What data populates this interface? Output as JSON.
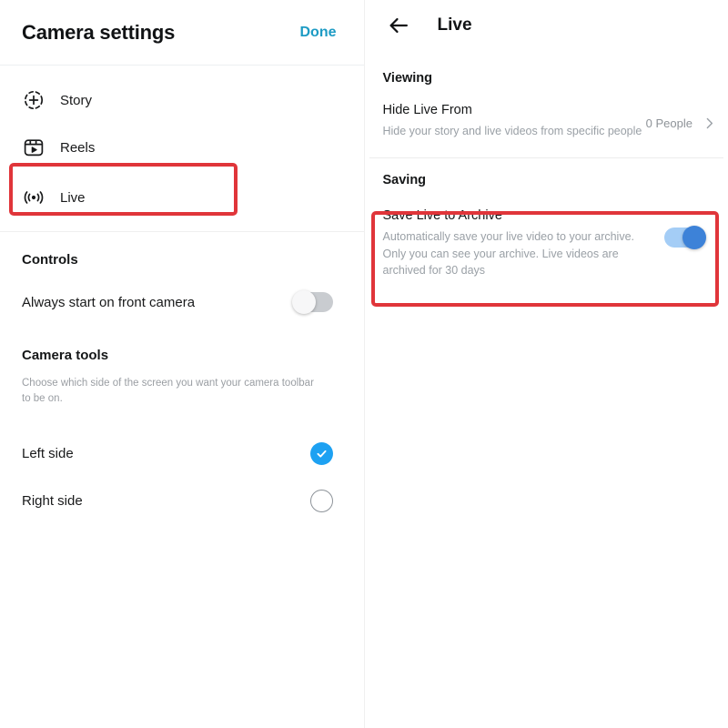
{
  "left_panel": {
    "title": "Camera settings",
    "done_label": "Done",
    "modes": [
      {
        "label": "Story",
        "icon": "story-add-icon"
      },
      {
        "label": "Reels",
        "icon": "reels-clapper-icon"
      },
      {
        "label": "Live",
        "icon": "live-broadcast-icon"
      }
    ],
    "controls": {
      "section_title": "Controls",
      "front_camera_label": "Always start on front camera",
      "front_camera_state": "off"
    },
    "camera_tools": {
      "section_title": "Camera tools",
      "description": "Choose which side of the screen you want your camera toolbar to be on.",
      "options": [
        {
          "label": "Left side",
          "selected": true,
          "control": "check-icon"
        },
        {
          "label": "Right side",
          "selected": false,
          "control": "radio-empty-icon"
        }
      ]
    }
  },
  "right_panel": {
    "back_icon": "back-arrow-icon",
    "title": "Live",
    "viewing": {
      "section_title": "Viewing",
      "row": {
        "title": "Hide Live From",
        "subtitle": "Hide your story and live videos from specific people",
        "value": "0 People",
        "chevron": "chevron-right-icon"
      }
    },
    "saving": {
      "section_title": "Saving",
      "row": {
        "title": "Save Live to Archive",
        "subtitle": "Automatically save your live video to your archive. Only you can see your archive. Live videos are archived for 30 days",
        "toggle_state": "on"
      }
    }
  },
  "annotations": {
    "highlight_color": "#e0353a",
    "highlights": [
      {
        "name": "live-menu-item-highlight"
      },
      {
        "name": "save-live-to-archive-highlight"
      }
    ]
  },
  "colors": {
    "accent_blue": "#1da1f2",
    "done_blue": "#1d9bc4",
    "toggle_on_track": "#a4cdf6",
    "toggle_on_knob": "#3d82d8",
    "toggle_off_track": "#c9ccd0",
    "muted_text": "#9aa0a6"
  }
}
